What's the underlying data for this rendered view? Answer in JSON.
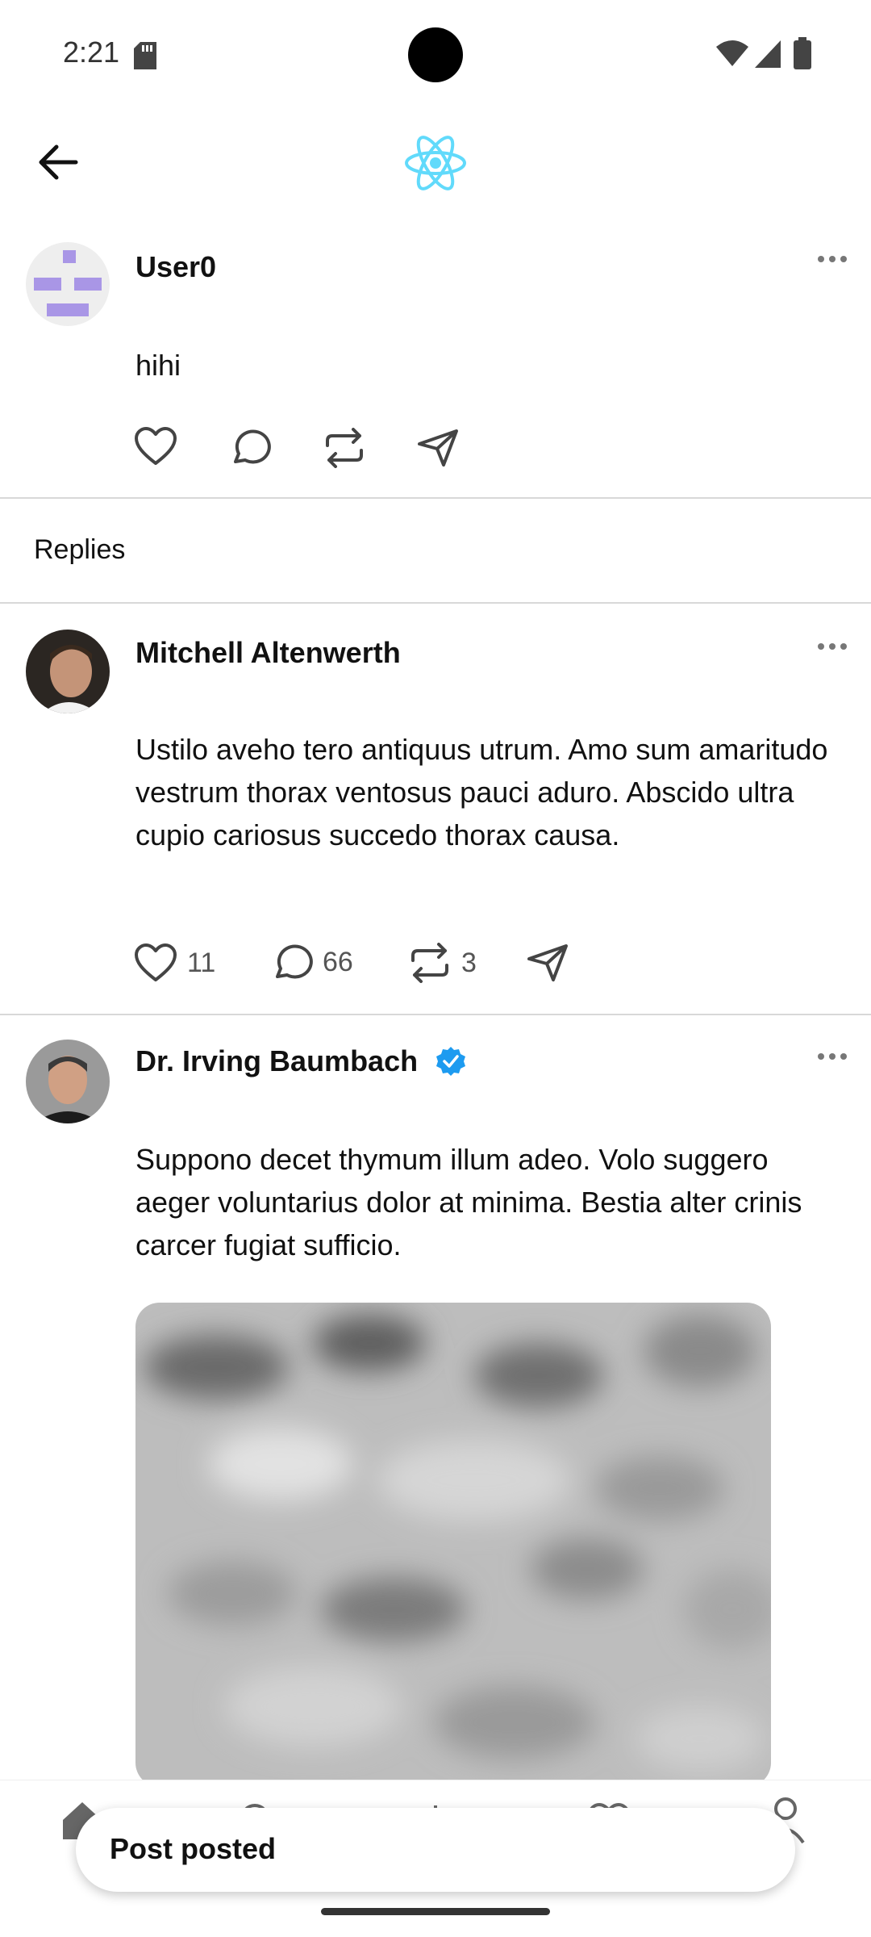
{
  "status_bar": {
    "time": "2:21"
  },
  "colors": {
    "accent": "#61DAFB",
    "verified": "#1D9BF0",
    "divider": "#D8D8D8"
  },
  "header": {
    "back_icon": "arrow-left-icon",
    "logo_icon": "react-logo-icon"
  },
  "main_post": {
    "author": "User0",
    "text": "hihi",
    "actions": [
      "heart-icon",
      "comment-icon",
      "repost-icon",
      "send-icon"
    ]
  },
  "replies_label": "Replies",
  "replies": [
    {
      "author": "Mitchell Altenwerth",
      "verified": false,
      "text": "Ustilo aveho tero antiquus utrum. Amo sum amaritudo vestrum thorax ventosus pauci aduro. Abscido ultra cupio cariosus succedo thorax causa.",
      "likes": "11",
      "comments": "66",
      "reposts": "3"
    },
    {
      "author": "Dr. Irving Baumbach",
      "verified": true,
      "text": "Suppono decet thymum illum adeo. Volo suggero aeger voluntarius dolor at minima. Bestia alter crinis carcer fugiat sufficio.",
      "image": "blurred-photo"
    }
  ],
  "tabbar": {
    "items": [
      "home-icon",
      "search-icon",
      "compose-icon",
      "heart-icon",
      "profile-icon"
    ]
  },
  "toast": {
    "message": "Post posted"
  }
}
